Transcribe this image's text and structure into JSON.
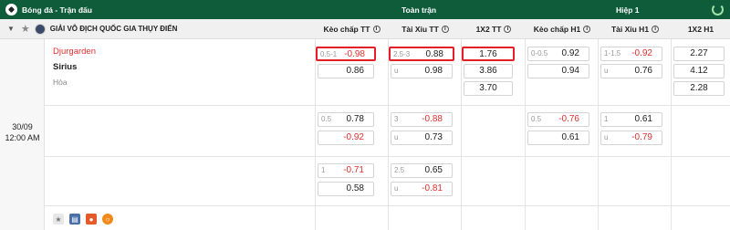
{
  "topbar": {
    "breadcrumb": "Bóng đá - Trận đấu",
    "full_match": "Toàn trận",
    "half": "Hiệp 1"
  },
  "league": {
    "name": "GIẢI VÔ ĐỊCH QUỐC GIA THỤY ĐIỂN"
  },
  "columns": [
    "Kèo chấp TT",
    "Tài Xỉu TT",
    "1X2 TT",
    "Kèo chấp H1",
    "Tài Xỉu H1",
    "1X2 H1"
  ],
  "match": {
    "date": "30/09",
    "time": "12:00 AM",
    "home": "Djurgarden",
    "away": "Sirius",
    "draw": "Hòa"
  },
  "rows": [
    {
      "hdp_tt": [
        {
          "line": "0.5-1",
          "odds": "-0.98"
        },
        {
          "line": "",
          "odds": "0.86"
        }
      ],
      "ou_tt": [
        {
          "line": "2.5-3",
          "odds": "0.88"
        },
        {
          "line": "u",
          "odds": "0.98"
        }
      ],
      "x12_tt": [
        "1.76",
        "3.86",
        "3.70"
      ],
      "hdp_h1": [
        {
          "line": "0-0.5",
          "odds": "0.92"
        },
        {
          "line": "",
          "odds": "0.94"
        }
      ],
      "ou_h1": [
        {
          "line": "1-1.5",
          "odds": "-0.92"
        },
        {
          "line": "u",
          "odds": "0.76"
        }
      ],
      "x12_h1": [
        "2.27",
        "4.12",
        "2.28"
      ]
    },
    {
      "hdp_tt": [
        {
          "line": "0.5",
          "odds": "0.78"
        },
        {
          "line": "",
          "odds": "-0.92"
        }
      ],
      "ou_tt": [
        {
          "line": "3",
          "odds": "-0.88"
        },
        {
          "line": "u",
          "odds": "0.73"
        }
      ],
      "hdp_h1": [
        {
          "line": "0.5",
          "odds": "-0.76"
        },
        {
          "line": "",
          "odds": "0.61"
        }
      ],
      "ou_h1": [
        {
          "line": "1",
          "odds": "0.61"
        },
        {
          "line": "u",
          "odds": "-0.79"
        }
      ]
    },
    {
      "hdp_tt": [
        {
          "line": "1",
          "odds": "-0.71"
        },
        {
          "line": "",
          "odds": "0.58"
        }
      ],
      "ou_tt": [
        {
          "line": "2.5",
          "odds": "0.65"
        },
        {
          "line": "u",
          "odds": "-0.81"
        }
      ]
    }
  ],
  "colors": {
    "topbar": "#0f5c3b",
    "selection": "#e41e2b",
    "negative": "#e03030"
  }
}
